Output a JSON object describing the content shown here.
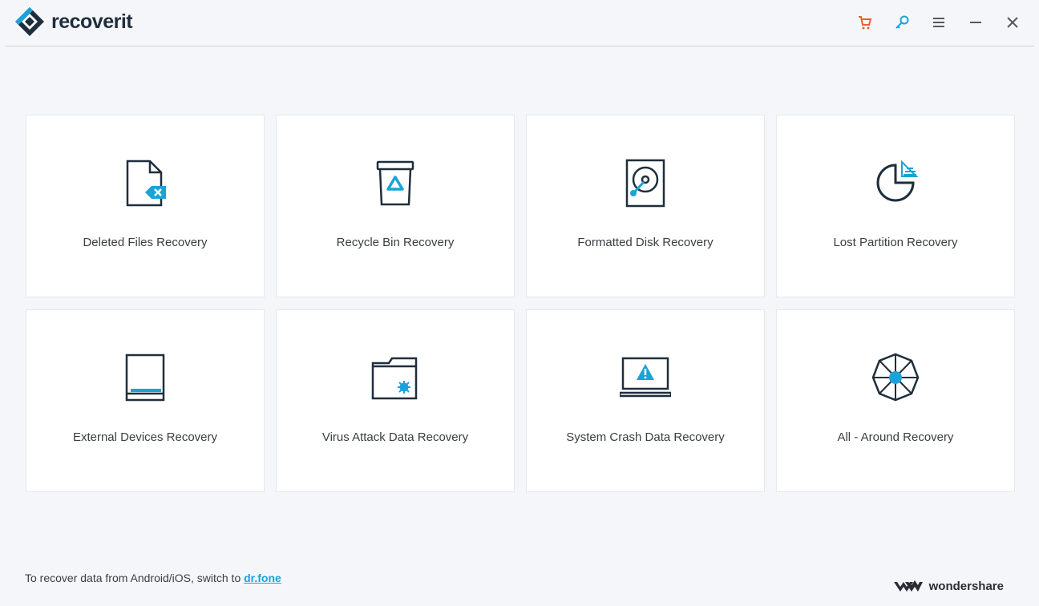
{
  "app": {
    "logo_text": "recoverit",
    "accent": "#1aa3d8",
    "dark": "#1f2e3c",
    "cart_color": "#e8612c"
  },
  "window_controls": [
    {
      "name": "cart-icon"
    },
    {
      "name": "key-icon"
    },
    {
      "name": "menu-icon"
    },
    {
      "name": "minimize-icon"
    },
    {
      "name": "close-icon"
    }
  ],
  "cards": [
    {
      "label": "Deleted Files Recovery",
      "icon": "deleted-file-icon"
    },
    {
      "label": "Recycle Bin Recovery",
      "icon": "recycle-bin-icon"
    },
    {
      "label": "Formatted Disk Recovery",
      "icon": "hard-disk-icon"
    },
    {
      "label": "Lost Partition Recovery",
      "icon": "partition-pie-icon"
    },
    {
      "label": "External Devices Recovery",
      "icon": "external-drive-icon"
    },
    {
      "label": "Virus Attack Data Recovery",
      "icon": "virus-folder-icon"
    },
    {
      "label": "System Crash Data Recovery",
      "icon": "crashed-laptop-icon"
    },
    {
      "label": "All - Around Recovery",
      "icon": "all-around-wheel-icon"
    }
  ],
  "footer": {
    "text": "To recover data from Android/iOS, switch to ",
    "link": "dr.fone",
    "brand": "wondershare"
  }
}
